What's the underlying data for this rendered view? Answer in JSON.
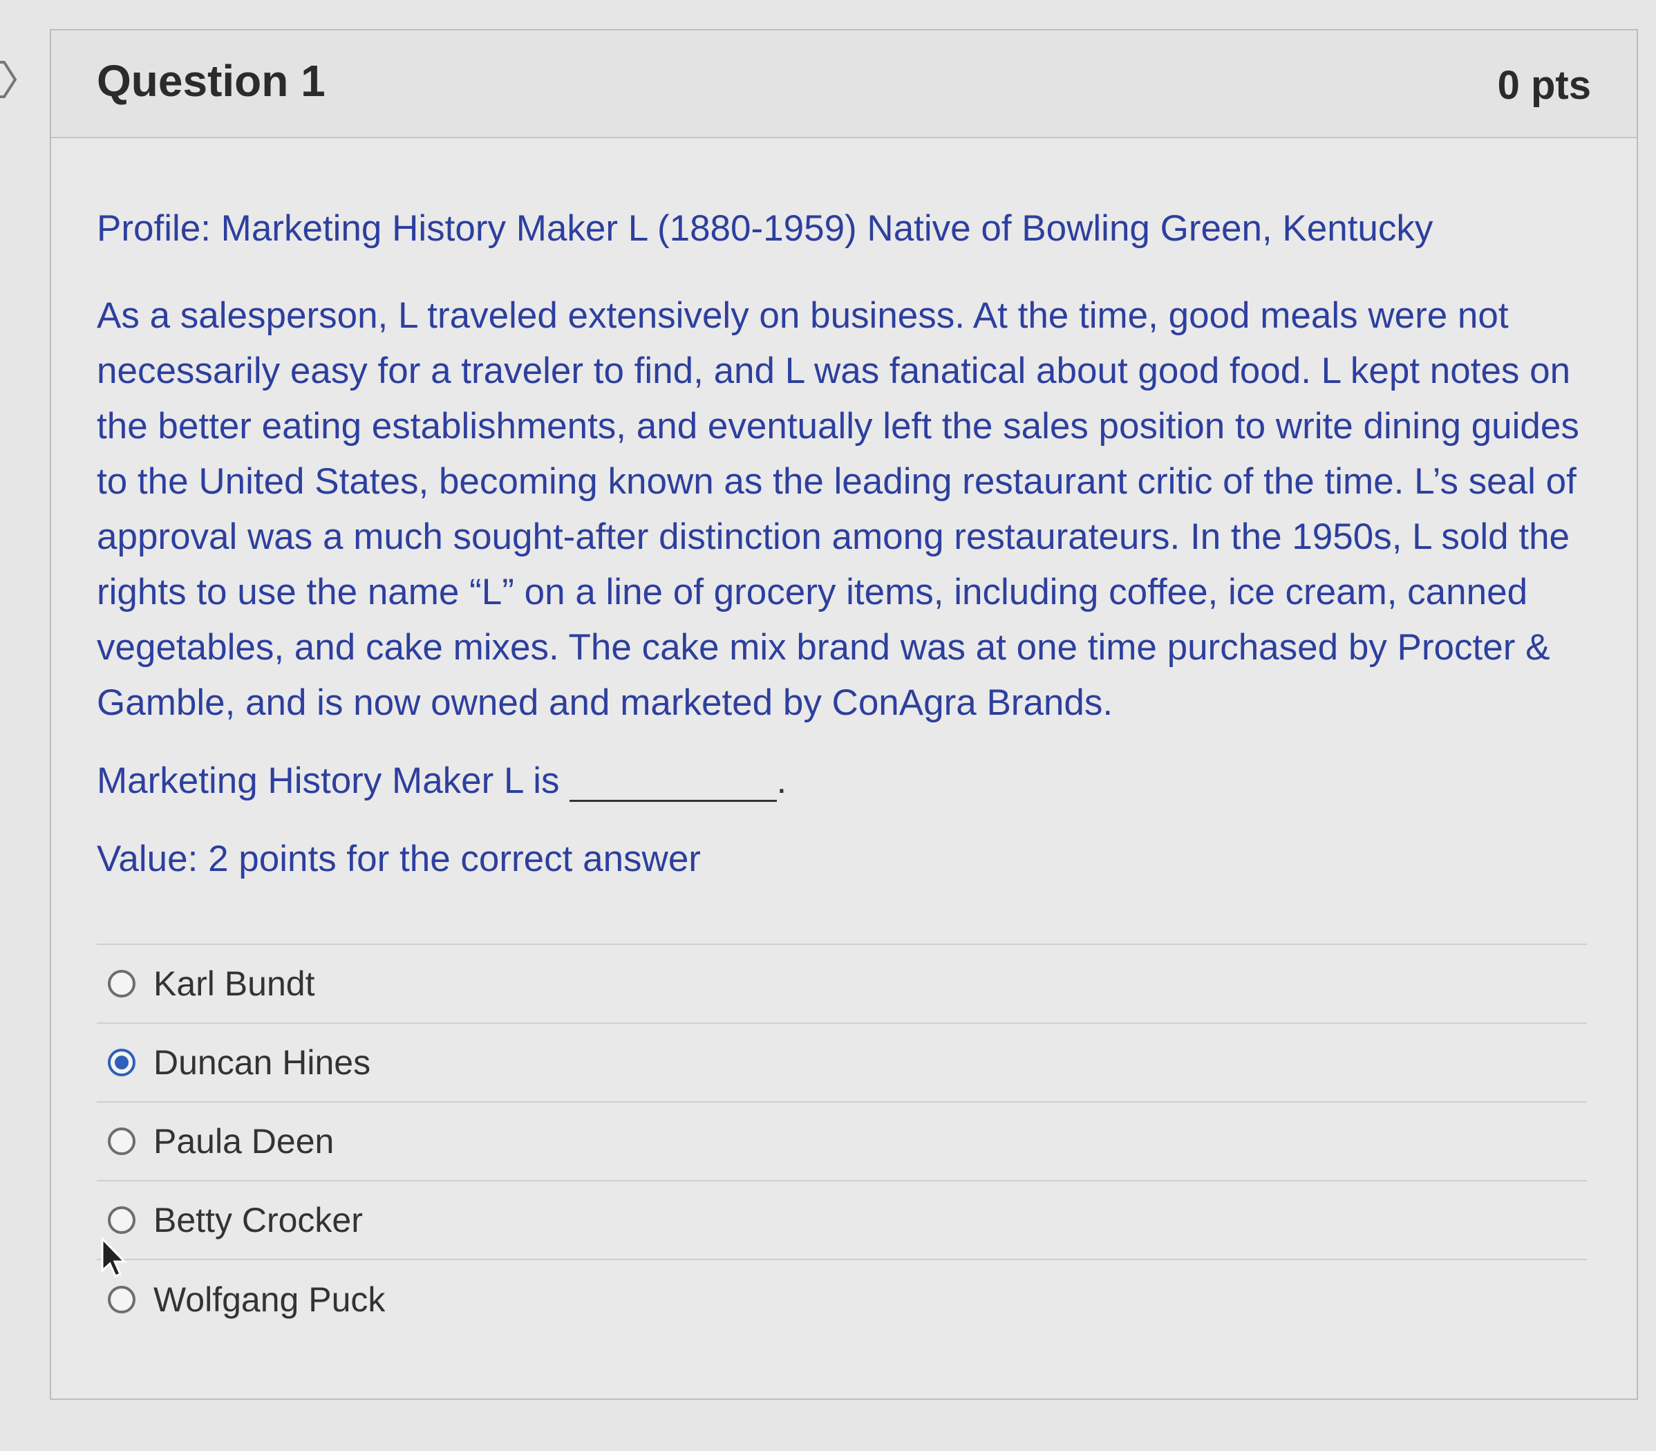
{
  "question": {
    "title": "Question 1",
    "points": "0 pts"
  },
  "profile": "Profile: Marketing History Maker L (1880-1959) Native of Bowling Green, Kentucky",
  "passage": "As a salesperson, L traveled extensively on business. At the time, good meals were not necessarily easy for a traveler to find, and L was fanatical about good food. L kept notes on the better eating establishments, and eventually left the sales position to write dining guides to the United States, becoming known as the leading restaurant critic of the time. L’s seal of approval was a much sought-after distinction among restaurateurs. In the 1950s, L sold the rights to use the name “L” on a line of grocery items, including coffee, ice cream, canned vegetables, and cake mixes. The cake mix brand was at one time purchased by Procter & Gamble, and is now owned and marketed by ConAgra Brands.",
  "prompt": "Marketing History Maker L is",
  "prompt_end": ".",
  "value_text": "Value: 2 points for the correct answer",
  "answers": [
    {
      "label": "Karl Bundt",
      "selected": false
    },
    {
      "label": "Duncan Hines",
      "selected": true
    },
    {
      "label": "Paula Deen",
      "selected": false
    },
    {
      "label": "Betty Crocker",
      "selected": false
    },
    {
      "label": "Wolfgang Puck",
      "selected": false
    }
  ],
  "icons": {
    "flag": "flag-icon",
    "radio": "radio-icon",
    "cursor": "mouse-cursor-icon"
  },
  "colors": {
    "text_blue": "#2d3f9e",
    "radio_selected": "#2f5fb8"
  }
}
